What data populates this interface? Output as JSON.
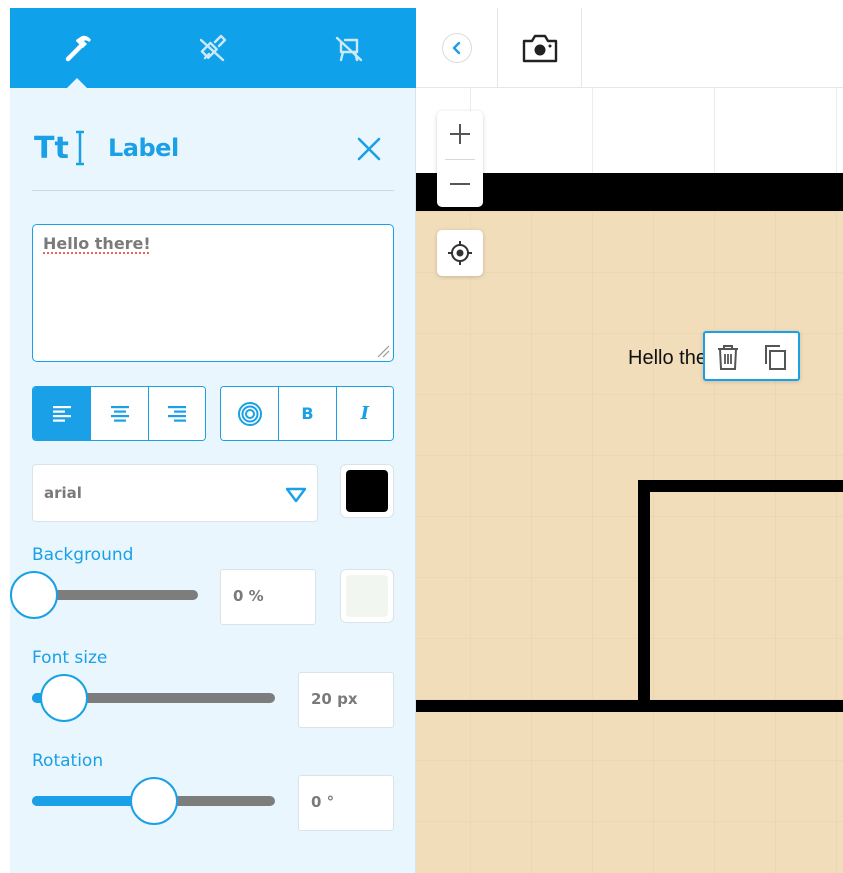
{
  "tool_tabs": [
    {
      "icon": "hammer-icon",
      "active": true
    },
    {
      "icon": "paint-roller-icon",
      "active": false
    },
    {
      "icon": "furniture-icon",
      "active": false
    }
  ],
  "label_panel": {
    "title": "Label",
    "text": "Hello there!",
    "align_buttons": [
      "align-left",
      "align-center",
      "align-right"
    ],
    "align_active": "align-left",
    "style_buttons": {
      "outline": "outline-icon",
      "bold": "B",
      "italic": "I"
    },
    "font": "arial",
    "text_color": "#000000",
    "background": {
      "label": "Background",
      "value_text": "0 %",
      "fraction": 0,
      "color": "#f2f6f1"
    },
    "font_size": {
      "label": "Font size",
      "value_text": "20 px",
      "fraction": 0.13
    },
    "rotation": {
      "label": "Rotation",
      "value_text": "0 °",
      "fraction": 0.5
    }
  },
  "canvas": {
    "label_text": "Hello there!",
    "colors": {
      "floor": "#f1ddba",
      "wall": "#000000",
      "accent": "#1aa0e6"
    }
  }
}
